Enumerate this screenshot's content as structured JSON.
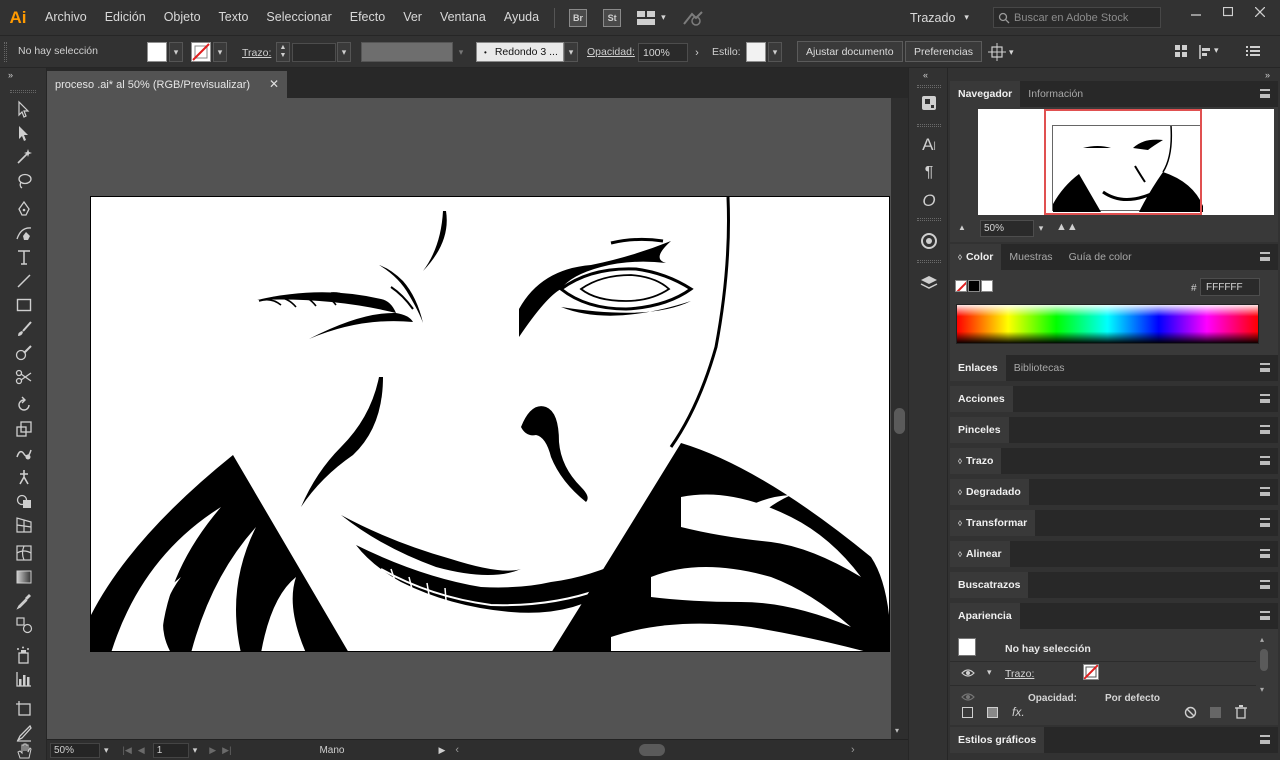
{
  "app": {
    "logo": "Ai",
    "title": "proceso .ai* al 50% (RGB/Previsualizar)"
  },
  "menu": [
    "Archivo",
    "Edición",
    "Objeto",
    "Texto",
    "Seleccionar",
    "Efecto",
    "Ver",
    "Ventana",
    "Ayuda"
  ],
  "menubar_badges": [
    "Br",
    "St"
  ],
  "workspace": "Trazado",
  "stock_search_placeholder": "Buscar en Adobe Stock",
  "control": {
    "selection_status": "No hay selección",
    "stroke_label": "Trazo:",
    "brush_preset": "Redondo 3 ...",
    "opacity_label": "Opacidad:",
    "opacity_value": "100%",
    "style_label": "Estilo:",
    "adjust_document": "Ajustar documento",
    "preferences": "Preferencias"
  },
  "status": {
    "zoom": "50%",
    "artboard_number": "1",
    "tool": "Mano"
  },
  "navigator": {
    "tabs": [
      "Navegador",
      "Información"
    ],
    "zoom": "50%"
  },
  "color_panel": {
    "tabs": [
      "Color",
      "Muestras",
      "Guía de color"
    ],
    "hex_label": "#",
    "hex_value": "FFFFFF"
  },
  "links_panel": {
    "tabs": [
      "Enlaces",
      "Bibliotecas"
    ]
  },
  "collapsed_panels": [
    {
      "label": "Acciones",
      "arrow": false
    },
    {
      "label": "Pinceles",
      "arrow": false
    },
    {
      "label": "Trazo",
      "arrow": true
    },
    {
      "label": "Degradado",
      "arrow": true
    },
    {
      "label": "Transformar",
      "arrow": true
    },
    {
      "label": "Alinear",
      "arrow": true
    },
    {
      "label": "Buscatrazos",
      "arrow": false
    }
  ],
  "appearance": {
    "title": "Apariencia",
    "header": "No hay selección",
    "stroke_label": "Trazo:",
    "opacity_label": "Opacidad:",
    "opacity_value": "Por defecto",
    "fx_label": "fx."
  },
  "graphic_styles": "Estilos gráficos",
  "colors": {
    "accent_logo": "#ff9a00",
    "ui_dark": "#323232",
    "canvas": "#535353"
  }
}
